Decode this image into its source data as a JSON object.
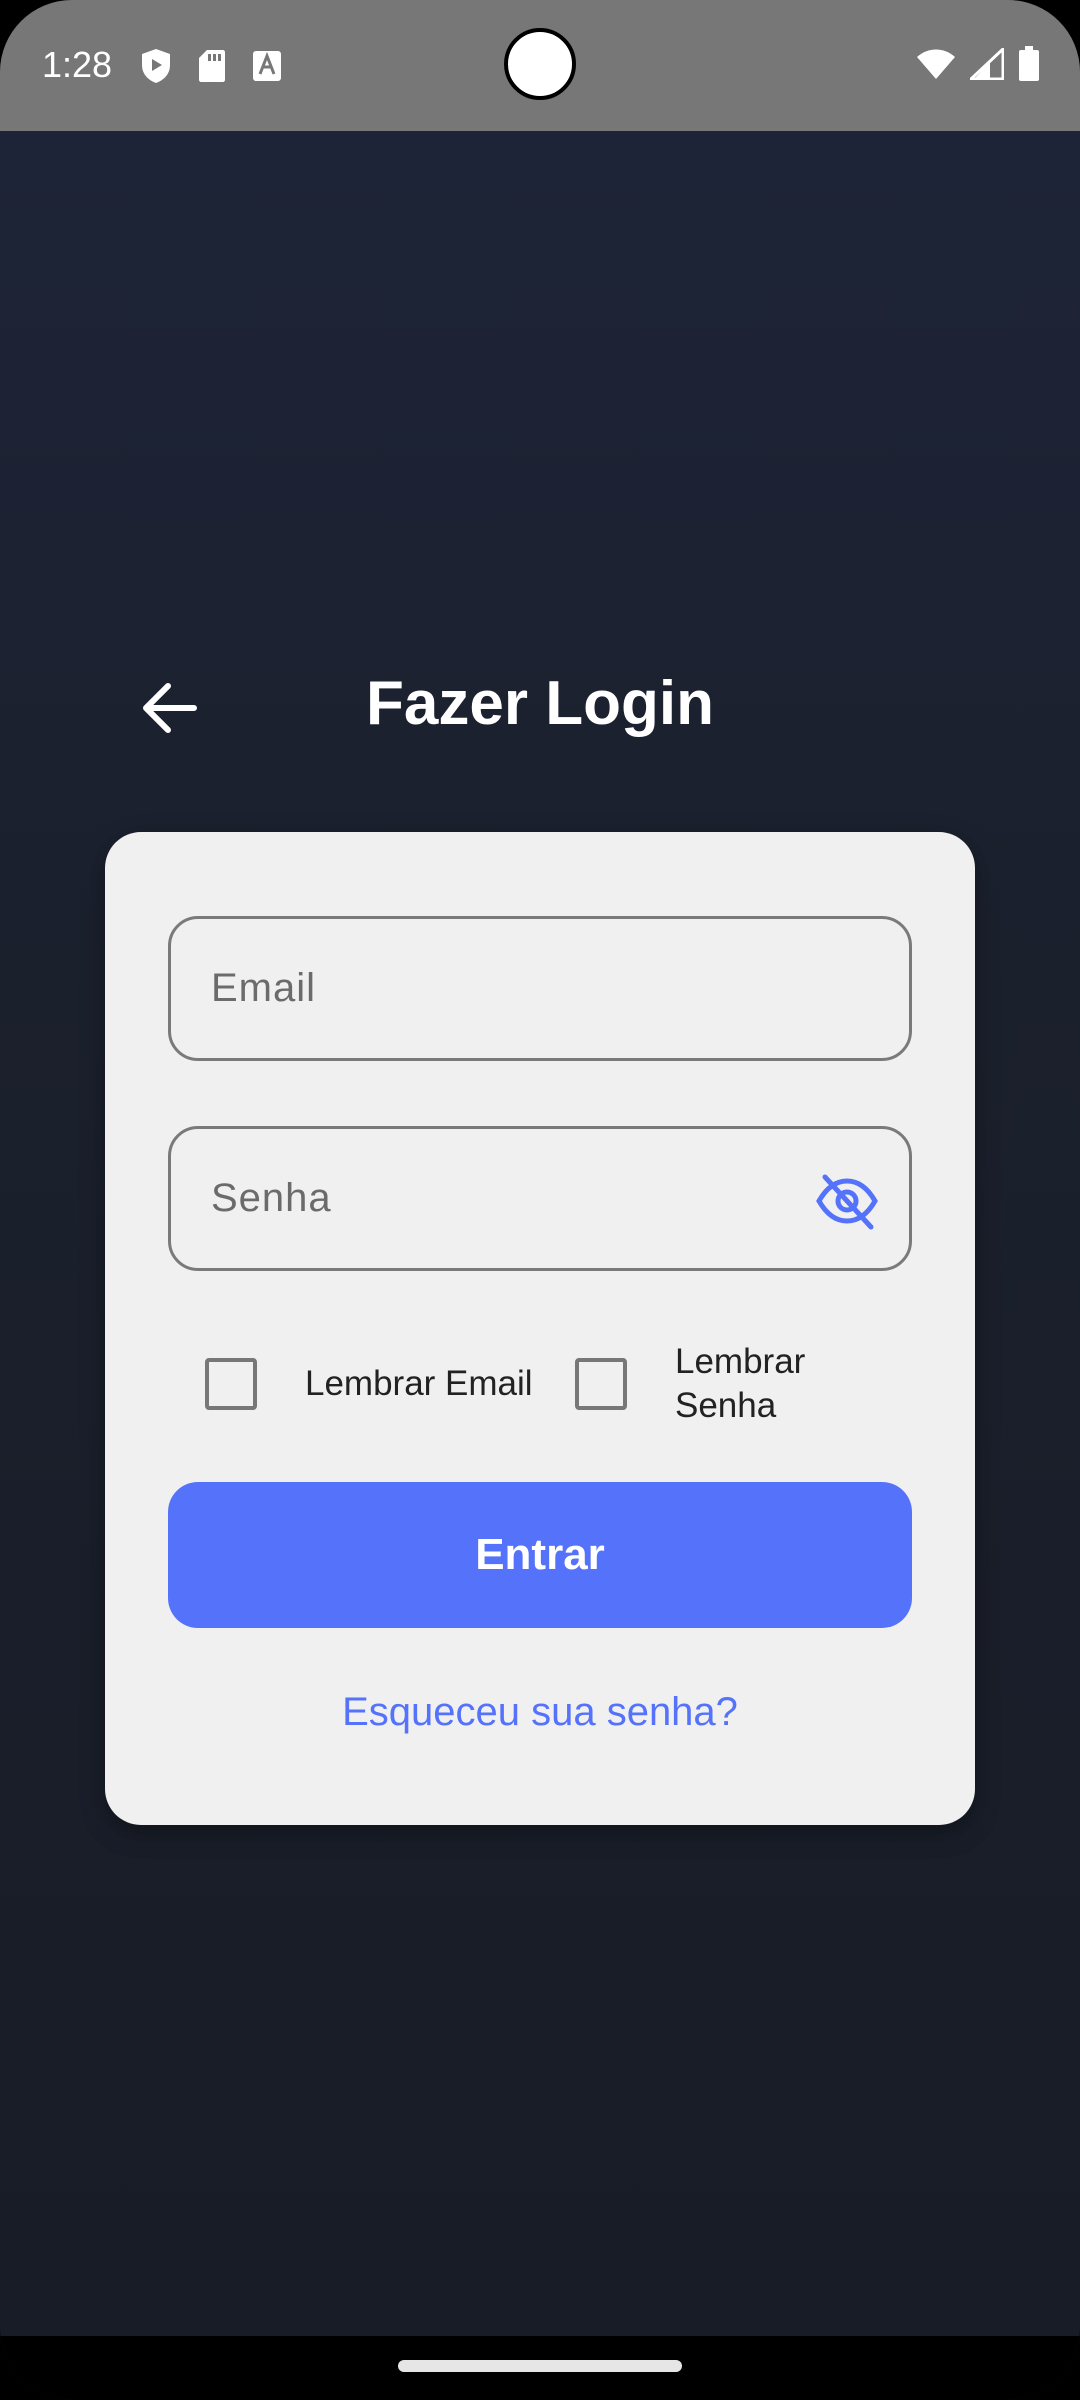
{
  "status_bar": {
    "time": "1:28",
    "left_icons": [
      "shield-icon",
      "sd-card-icon",
      "font-a-icon"
    ],
    "right_icons": [
      "wifi-icon",
      "cell-signal-icon",
      "battery-icon"
    ]
  },
  "header": {
    "title": "Fazer Login",
    "back_icon": "arrow-left-icon"
  },
  "form": {
    "email_placeholder": "Email",
    "email_value": "",
    "password_placeholder": "Senha",
    "password_value": "",
    "password_toggle_icon": "eye-off-icon",
    "remember_email_label": "Lembrar Email",
    "remember_email_checked": false,
    "remember_password_label": "Lembrar Senha",
    "remember_password_checked": false,
    "submit_label": "Entrar",
    "forgot_label": "Esqueceu sua senha?"
  },
  "colors": {
    "accent": "#5572fb",
    "background_top": "#1e2539",
    "background_bottom": "#181c26",
    "card": "#f0f0f0",
    "status_bar": "#777777"
  }
}
